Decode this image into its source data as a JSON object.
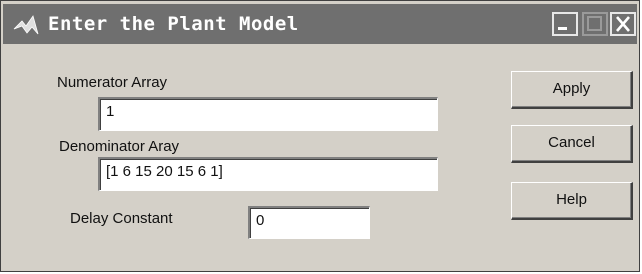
{
  "window": {
    "title": "Enter the Plant Model",
    "controls": [
      "minimize-icon",
      "maximize-icon",
      "close-icon"
    ]
  },
  "form": {
    "numerator_label": "Numerator Array",
    "numerator_value": "1",
    "denominator_label": "Denominator Aray",
    "denominator_value": "[1 6 15 20 15 6 1]",
    "delay_label": "Delay Constant",
    "delay_value": "0"
  },
  "buttons": {
    "apply": "Apply",
    "cancel": "Cancel",
    "help": "Help"
  },
  "colors": {
    "titlebar": "#6f6f6f",
    "window_bg": "#d4d0c8"
  }
}
